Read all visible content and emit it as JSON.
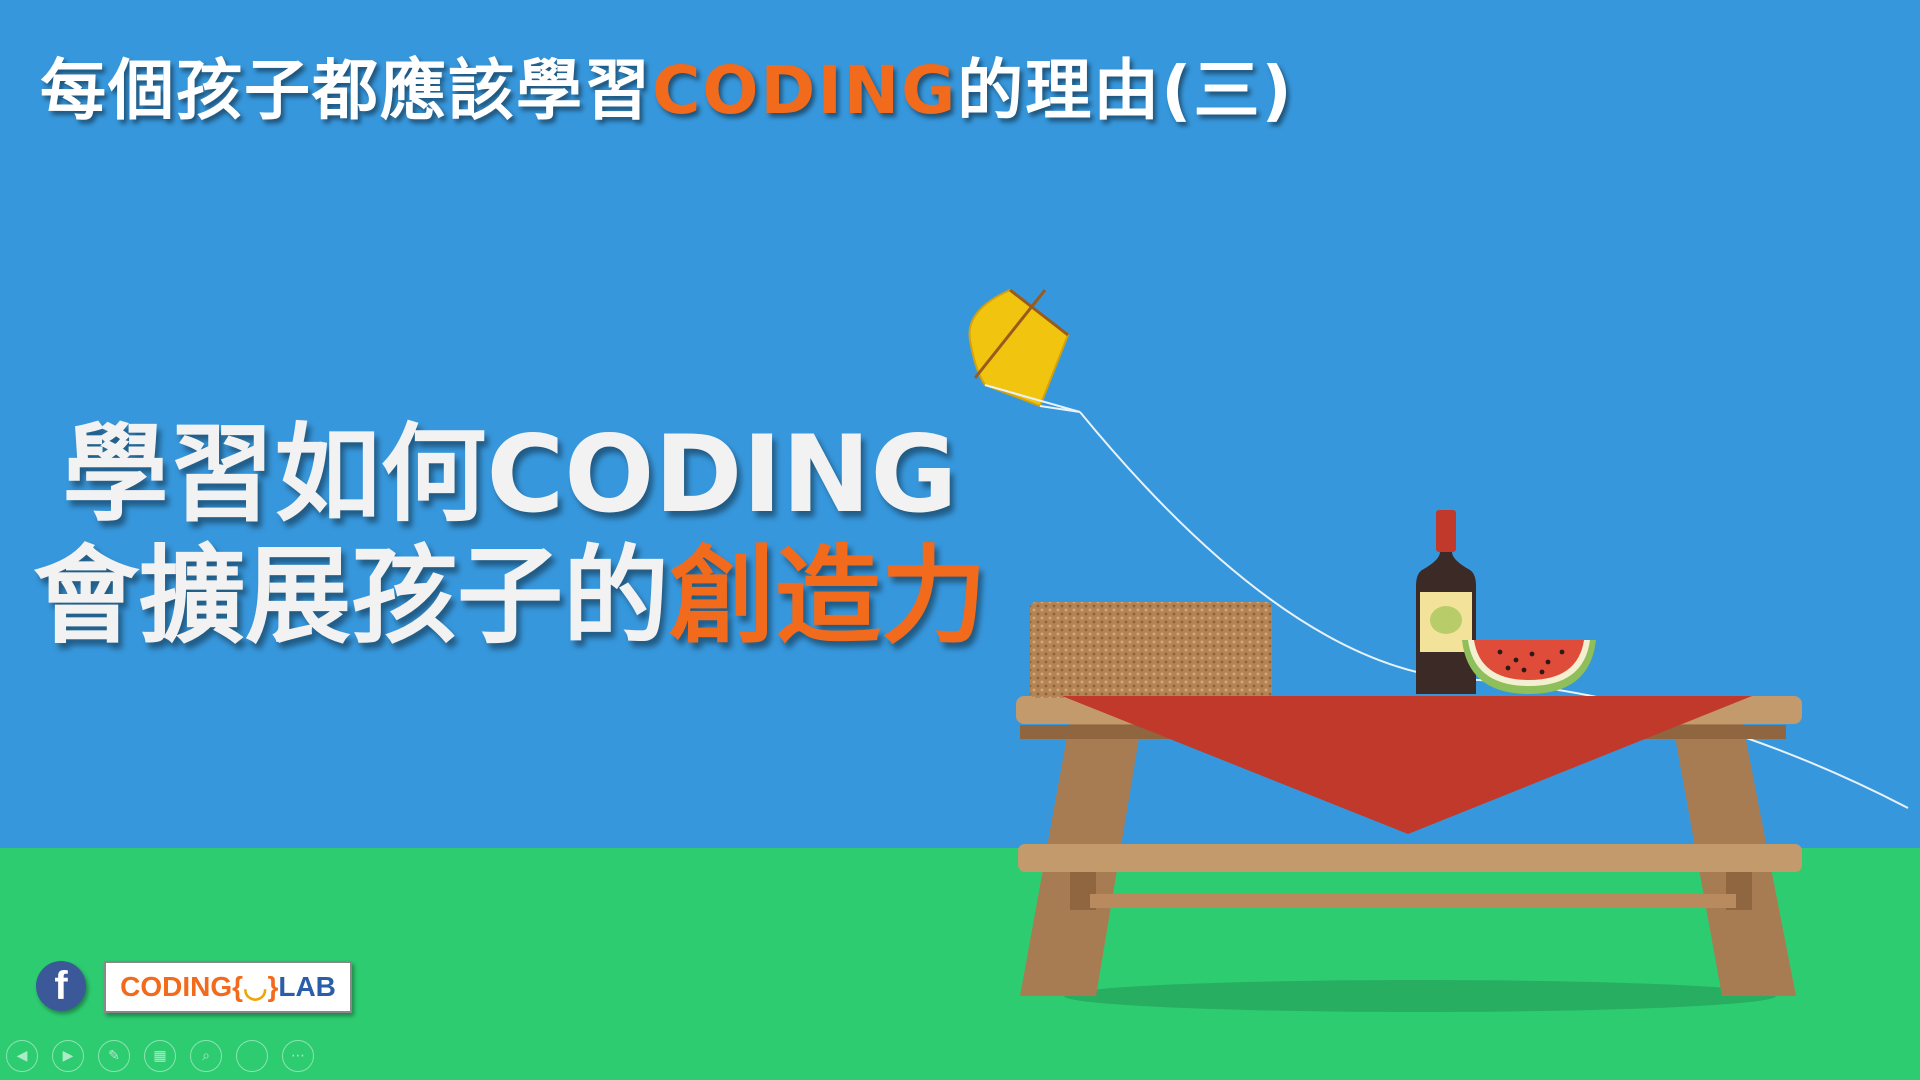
{
  "slide": {
    "title_part1": "每個孩子都應該學習",
    "title_highlight": "CODING",
    "title_part2": "的理由(三)",
    "headline_line1": "學習如何CODING",
    "headline_line2_part1": "會擴展孩子的",
    "headline_line2_highlight": "創造力"
  },
  "branding": {
    "facebook_glyph": "f",
    "logo_coding": "CODING",
    "logo_brace_open": "{",
    "logo_smile": "◡",
    "logo_brace_close": "}",
    "logo_lab": "LAB"
  },
  "controls": [
    {
      "name": "previous-slide-icon",
      "glyph": "◀"
    },
    {
      "name": "next-slide-icon",
      "glyph": "▶"
    },
    {
      "name": "pen-icon",
      "glyph": "✎"
    },
    {
      "name": "slides-grid-icon",
      "glyph": "▦"
    },
    {
      "name": "zoom-icon",
      "glyph": "⌕"
    },
    {
      "name": "blank-icon",
      "glyph": ""
    },
    {
      "name": "more-icon",
      "glyph": "⋯"
    }
  ],
  "colors": {
    "sky": "#3797dc",
    "grass": "#2ecc71",
    "accent_orange": "#f26a1b",
    "kite_yellow": "#f1c40f",
    "tablecloth_red": "#c0392b",
    "table_wood": "#b88a5e"
  }
}
